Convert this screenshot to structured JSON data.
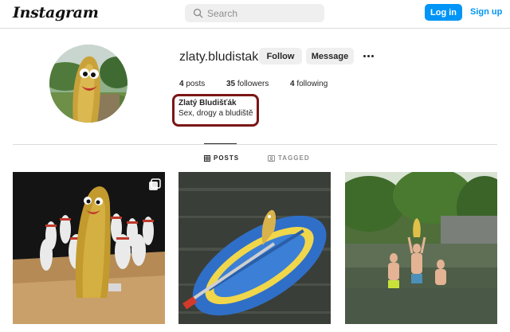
{
  "header": {
    "logo": "Instagram",
    "search_placeholder": "Search",
    "login_label": "Log in",
    "signup_label": "Sign up"
  },
  "profile": {
    "username": "zlaty.bludistak",
    "follow_label": "Follow",
    "message_label": "Message",
    "posts_count": "4",
    "posts_word": "posts",
    "followers_count": "35",
    "followers_word": "followers",
    "following_count": "4",
    "following_word": "following",
    "full_name": "Zlatý Bludišťák",
    "bio": "Sex, drogy a bludiště"
  },
  "tabs": {
    "posts_label": "POSTS",
    "tagged_label": "TAGGED"
  },
  "colors": {
    "accent": "#0095f6",
    "highlight_border": "#7b1616"
  }
}
